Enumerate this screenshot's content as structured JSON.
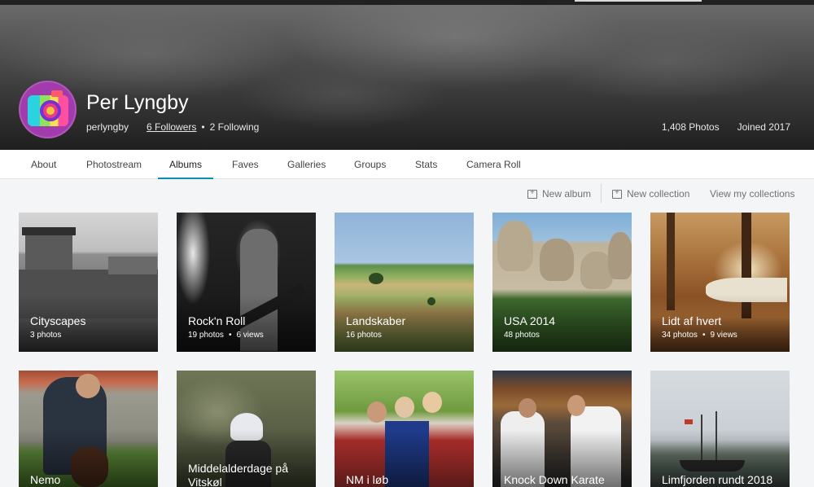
{
  "profile": {
    "name": "Per Lyngby",
    "username": "perlyngby",
    "followers": "6 Followers",
    "following": "2 Following",
    "photos": "1,408 Photos",
    "joined": "Joined 2017"
  },
  "tabs": [
    "About",
    "Photostream",
    "Albums",
    "Faves",
    "Galleries",
    "Groups",
    "Stats",
    "Camera Roll"
  ],
  "active_tab": "Albums",
  "toolbar": {
    "new_album": "New album",
    "new_collection": "New collection",
    "view_collections": "View my collections"
  },
  "albums": [
    {
      "title": "Cityscapes",
      "photos": "3 photos",
      "views": ""
    },
    {
      "title": "Rock'n Roll",
      "photos": "19 photos",
      "views": "6 views"
    },
    {
      "title": "Landskaber",
      "photos": "16 photos",
      "views": ""
    },
    {
      "title": "USA 2014",
      "photos": "48 photos",
      "views": ""
    },
    {
      "title": "Lidt af hvert",
      "photos": "34 photos",
      "views": "9 views"
    },
    {
      "title": "Nemo",
      "photos": "",
      "views": ""
    },
    {
      "title": "Middelalderdage på Vitskøl",
      "photos": "",
      "views": ""
    },
    {
      "title": "NM i løb",
      "photos": "",
      "views": ""
    },
    {
      "title": "Knock Down Karate",
      "photos": "",
      "views": ""
    },
    {
      "title": "Limfjorden rundt 2018",
      "photos": "",
      "views": ""
    }
  ],
  "colors": {
    "accent": "#0a8fb0",
    "background": "#f3f5f6",
    "tab_text": "#444444"
  }
}
